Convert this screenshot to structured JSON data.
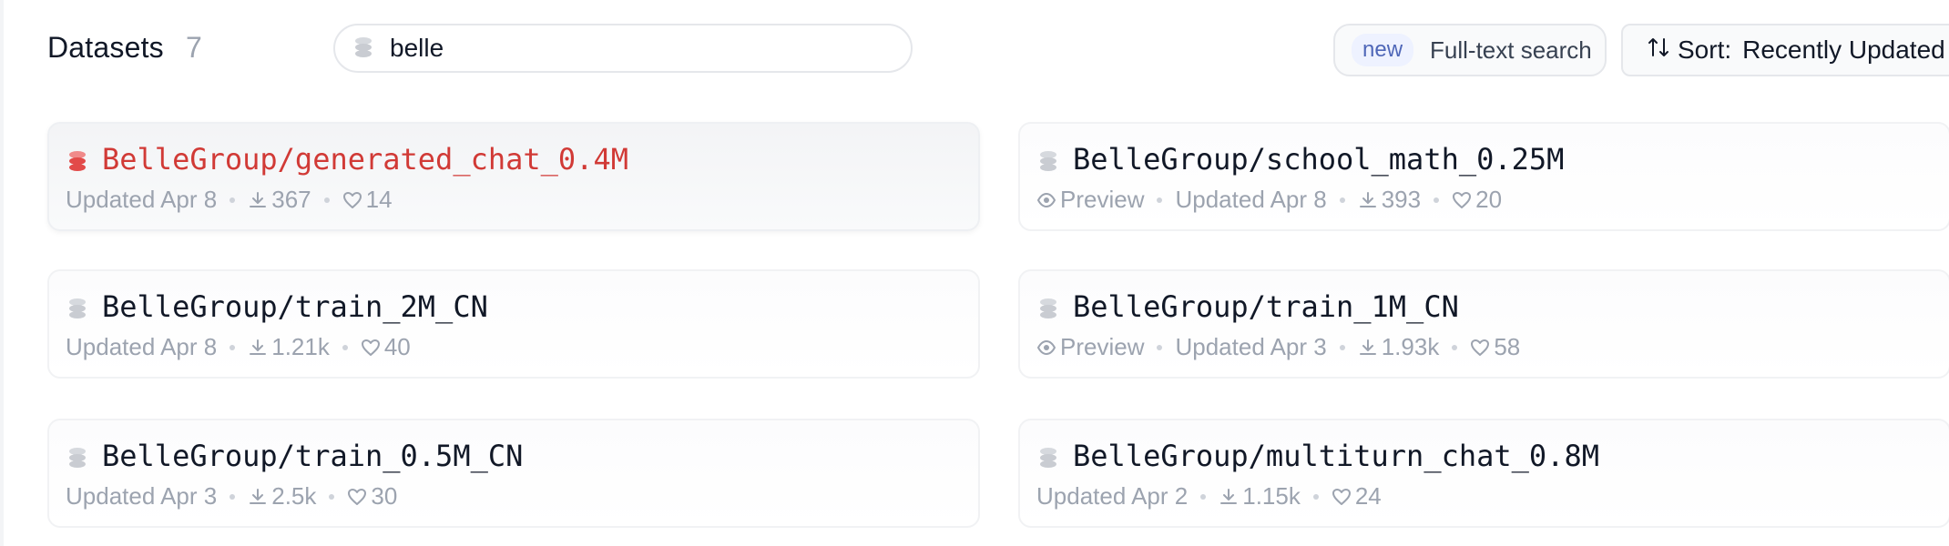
{
  "header": {
    "title": "Datasets",
    "count": "7",
    "search": {
      "value": "belle"
    },
    "full_text": {
      "badge": "new",
      "label": "Full-text search"
    },
    "sort": {
      "icon": "sort-arrows-icon",
      "prefix": "Sort:",
      "value": "Recently Updated"
    }
  },
  "datasets": [
    {
      "name": "BelleGroup/generated_chat_0.4M",
      "preview": "",
      "updated": "Updated Apr 8",
      "downloads": "367",
      "likes": "14"
    },
    {
      "name": "BelleGroup/school_math_0.25M",
      "preview": "Preview",
      "updated": "Updated Apr 8",
      "downloads": "393",
      "likes": "20"
    },
    {
      "name": "BelleGroup/train_2M_CN",
      "preview": "",
      "updated": "Updated Apr 8",
      "downloads": "1.21k",
      "likes": "40"
    },
    {
      "name": "BelleGroup/train_1M_CN",
      "preview": "Preview",
      "updated": "Updated Apr 3",
      "downloads": "1.93k",
      "likes": "58"
    },
    {
      "name": "BelleGroup/train_0.5M_CN",
      "preview": "",
      "updated": "Updated Apr 3",
      "downloads": "2.5k",
      "likes": "30"
    },
    {
      "name": "BelleGroup/multiturn_chat_0.8M",
      "preview": "",
      "updated": "Updated Apr 2",
      "downloads": "1.15k",
      "likes": "24"
    }
  ],
  "colors": {
    "accent_red": "#d13a36",
    "badge_blue": "#4f67b8",
    "muted": "#9ca3af"
  }
}
